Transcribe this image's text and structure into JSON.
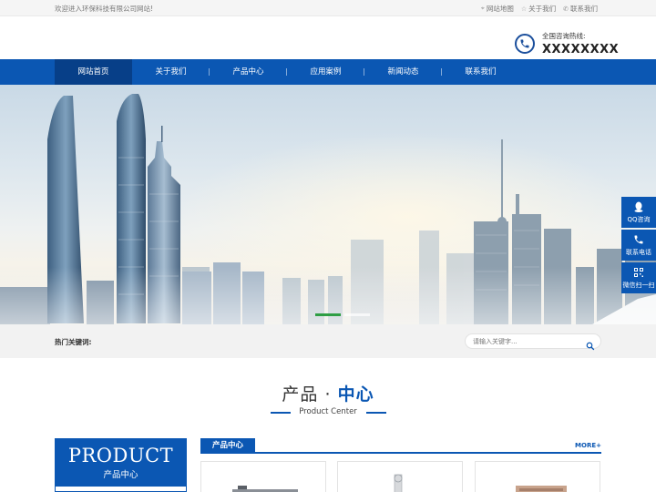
{
  "topbar": {
    "welcome": "欢迎进入环保科技有限公司网站!",
    "links": [
      {
        "label": "网站地图",
        "icon": "map-pin-icon"
      },
      {
        "label": "关于我们",
        "icon": "star-icon"
      },
      {
        "label": "联系我们",
        "icon": "contact-icon"
      }
    ]
  },
  "header": {
    "hotline_label": "全国咨询热线:",
    "hotline_number": "XXXXXXXX"
  },
  "nav": {
    "items": [
      "网站首页",
      "关于我们",
      "产品中心",
      "应用案例",
      "新闻动态",
      "联系我们"
    ],
    "active_index": 0
  },
  "banner": {
    "slides": 2,
    "active_slide": 0
  },
  "search": {
    "hot_keywords_label": "热门关键词:",
    "placeholder": "请输入关键字..."
  },
  "section": {
    "title_part1": "产品",
    "title_dot": "·",
    "title_part2": "中心",
    "subtitle": "Product Center"
  },
  "product_box": {
    "en": "PRODUCT",
    "cn": "产品中心"
  },
  "product_center": {
    "tab": "产品中心",
    "more": "MORE+"
  },
  "float": [
    {
      "label": "QQ咨询",
      "icon": "qq-icon"
    },
    {
      "label": "联系电话",
      "icon": "phone-icon"
    },
    {
      "label": "微信扫一扫",
      "icon": "qrcode-icon"
    }
  ],
  "colors": {
    "brand_blue": "#0b57b3",
    "nav_active": "#073f88",
    "slide_indicator": "#2e9e44"
  }
}
